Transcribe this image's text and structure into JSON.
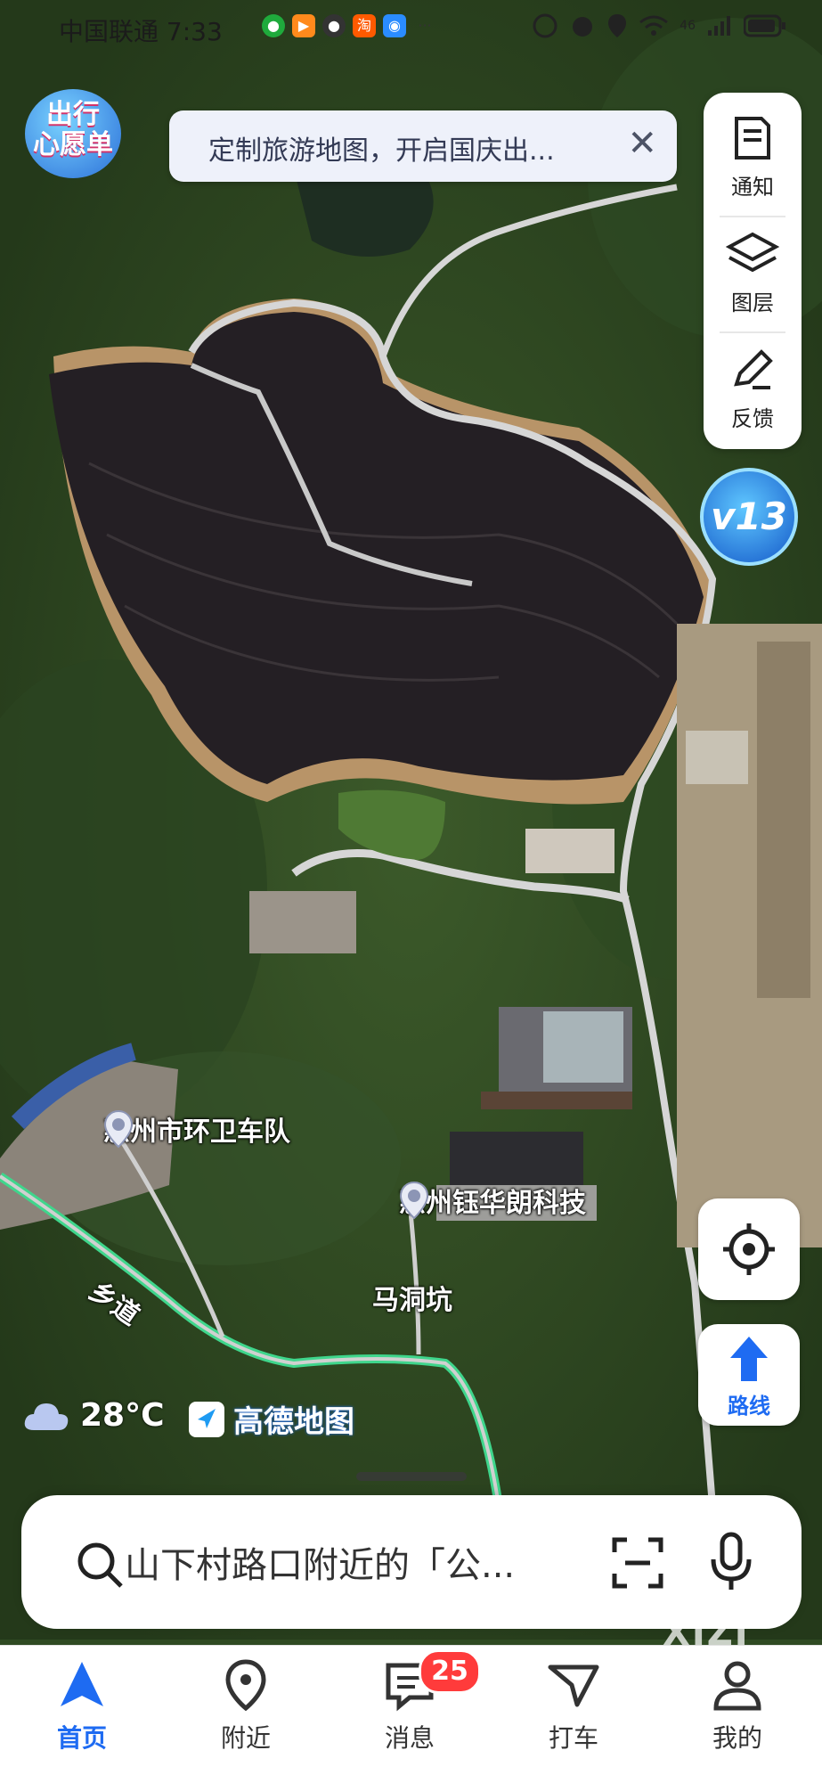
{
  "status_bar": {
    "carrier_time": "中国联通 7:33",
    "app_icons": [
      "淘"
    ],
    "network": "46"
  },
  "wish_badge": {
    "line1": "出行",
    "line2": "心愿单"
  },
  "banner": {
    "text": "定制旅游地图，开启国庆出...",
    "close": "✕"
  },
  "tools": [
    {
      "label": "通知",
      "icon": "notice-icon"
    },
    {
      "label": "图层",
      "icon": "layers-icon"
    },
    {
      "label": "反馈",
      "icon": "feedback-icon"
    }
  ],
  "v13_badge": "v13",
  "map": {
    "pois": [
      {
        "name": "惠州市环卫车队"
      },
      {
        "name": "惠州钰华朗科技"
      }
    ],
    "labels": {
      "village": "马洞坑",
      "road": "乡道"
    }
  },
  "weather": {
    "temp": "28°C",
    "icon": "cloud-icon"
  },
  "brand": "高德地图",
  "route_button": {
    "label": "路线"
  },
  "search": {
    "placeholder": "山下村路口附近的「公..."
  },
  "watermark": "XIZI",
  "nav": {
    "items": [
      {
        "label": "首页",
        "icon": "home-nav-icon",
        "active": true
      },
      {
        "label": "附近",
        "icon": "nearby-pin-icon",
        "active": false
      },
      {
        "label": "消息",
        "icon": "message-icon",
        "active": false,
        "badge": "25"
      },
      {
        "label": "打车",
        "icon": "taxi-icon",
        "active": false
      },
      {
        "label": "我的",
        "icon": "profile-icon",
        "active": false
      }
    ]
  },
  "colors": {
    "accent": "#1e6bf2",
    "badge": "#ff3b3b",
    "road": "#3fd68c"
  }
}
